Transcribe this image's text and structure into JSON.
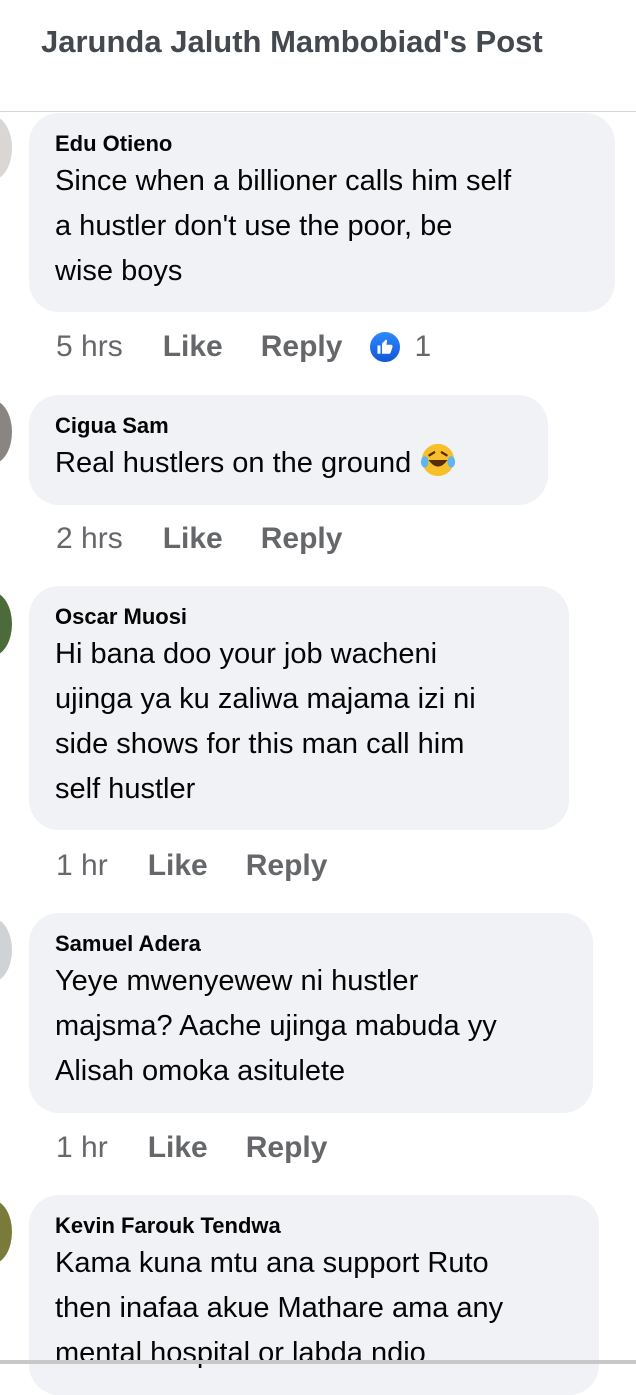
{
  "header": {
    "title": "Jarunda Jaluth Mambobiad's Post"
  },
  "comments": [
    {
      "author": "Edu Otieno",
      "lines": [
        "Since when a billioner calls him self",
        "a hustler don't use the poor, be",
        "wise boys"
      ],
      "time": "5 hrs",
      "like": "Like",
      "reply": "Reply",
      "reaction_count": "1"
    },
    {
      "author": "Cigua Sam",
      "lines": [
        "Real hustlers on the ground"
      ],
      "emoji": "laughing-tears-emoji",
      "time": "2 hrs",
      "like": "Like",
      "reply": "Reply"
    },
    {
      "author": "Oscar Muosi",
      "lines": [
        "Hi bana doo your job wacheni",
        "ujinga ya ku zaliwa majama izi ni",
        "side shows for this man call him",
        "self hustler"
      ],
      "time": "1 hr",
      "like": "Like",
      "reply": "Reply"
    },
    {
      "author": "Samuel Adera",
      "lines": [
        "Yeye mwenyewew ni  hustler",
        "majsma? Aache ujinga mabuda yy",
        "Alisah omoka asitulete"
      ],
      "time": "1 hr",
      "like": "Like",
      "reply": "Reply"
    },
    {
      "author": "Kevin Farouk Tendwa",
      "lines": [
        "Kama kuna mtu ana support Ruto",
        "then inafaa akue Mathare ama any",
        "mental hospital  or labda ndio"
      ]
    }
  ]
}
